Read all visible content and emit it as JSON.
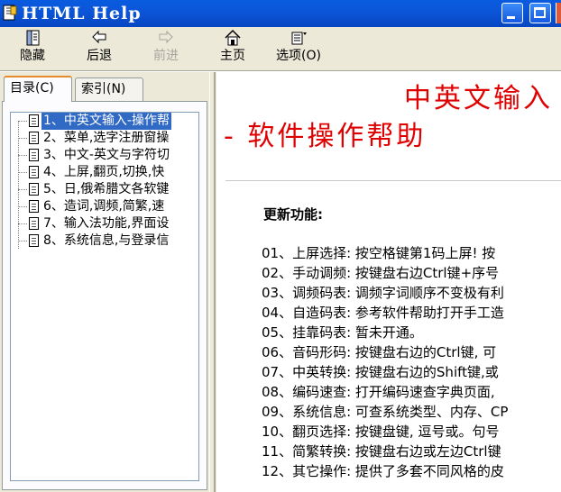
{
  "window": {
    "title": "HTML Help"
  },
  "toolbar": {
    "hide_label": "隐藏",
    "back_label": "后退",
    "forward_label": "前进",
    "home_label": "主页",
    "options_label": "选项(O)"
  },
  "tabs": {
    "contents_label": "目录(C)",
    "index_label": "索引(N)"
  },
  "tree": {
    "items": [
      "1、中英文输入-操作帮",
      "2、菜单,选字注册窗操",
      "3、中文-英文与字符切",
      "4、上屏,翻页,切换,快",
      "5、日,俄希腊文各软键",
      "6、造词,调频,简繁,速",
      "7、输入法功能,界面设",
      "8、系统信息,与登录信"
    ]
  },
  "content": {
    "title_line1": "中英文输入",
    "title_line2": "- 软件操作帮助",
    "section_title": "更新功能:",
    "features": [
      "01、上屏选择: 按空格键第1码上屏! 按",
      "02、手动调频: 按键盘右边Ctrl键+序号",
      "03、调频码表: 调频字词顺序不变极有利",
      "04、自造码表: 参考软件帮助打开手工造",
      "05、挂靠码表: 暂未开通。",
      "06、音码形码: 按键盘右边的Ctrl键, 可",
      "07、中英转换: 按键盘右边的Shift键,或",
      "08、编码速查: 打开编码速查字典页面,",
      "09、系统信息: 可查系统类型、内存、CP",
      "10、翻页选择: 按键盘键, 逗号或。句号",
      "11、简繁转换: 按键盘右边或左边Ctrl键",
      "12、其它操作: 提供了多套不同风格的皮"
    ]
  },
  "colors": {
    "title_red": "#E00000",
    "selection_blue": "#316AC5",
    "titlebar_blue": "#0A5BE0"
  }
}
